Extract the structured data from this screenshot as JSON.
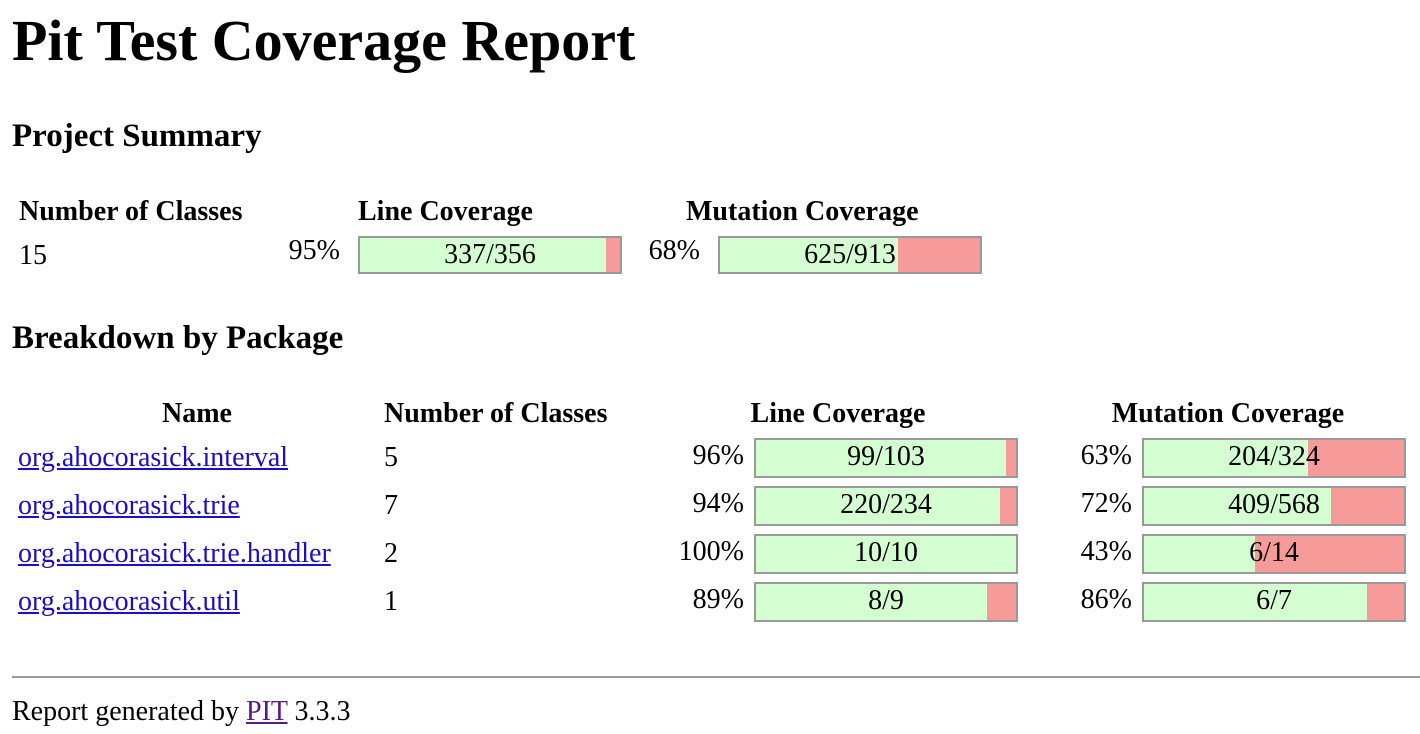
{
  "title": "Pit Test Coverage Report",
  "project_summary": {
    "heading": "Project Summary",
    "headers": {
      "classes": "Number of Classes",
      "line": "Line Coverage",
      "mutation": "Mutation Coverage"
    },
    "classes": "15",
    "line_pct": "95%",
    "line_ratio": "337/356",
    "line_fraction": 0.9466,
    "mutation_pct": "68%",
    "mutation_ratio": "625/913",
    "mutation_fraction": 0.6846
  },
  "breakdown": {
    "heading": "Breakdown by Package",
    "headers": {
      "name": "Name",
      "classes": "Number of Classes",
      "line": "Line Coverage",
      "mutation": "Mutation Coverage"
    },
    "rows": [
      {
        "name": "org.ahocorasick.interval",
        "classes": "5",
        "line_pct": "96%",
        "line_ratio": "99/103",
        "line_fraction": 0.9612,
        "mut_pct": "63%",
        "mut_ratio": "204/324",
        "mut_fraction": 0.6296
      },
      {
        "name": "org.ahocorasick.trie",
        "classes": "7",
        "line_pct": "94%",
        "line_ratio": "220/234",
        "line_fraction": 0.9402,
        "mut_pct": "72%",
        "mut_ratio": "409/568",
        "mut_fraction": 0.7201
      },
      {
        "name": "org.ahocorasick.trie.handler",
        "classes": "2",
        "line_pct": "100%",
        "line_ratio": "10/10",
        "line_fraction": 1.0,
        "mut_pct": "43%",
        "mut_ratio": "6/14",
        "mut_fraction": 0.4286
      },
      {
        "name": "org.ahocorasick.util",
        "classes": "1",
        "line_pct": "89%",
        "line_ratio": "8/9",
        "line_fraction": 0.8889,
        "mut_pct": "86%",
        "mut_ratio": "6/7",
        "mut_fraction": 0.8571
      }
    ]
  },
  "footer": {
    "prefix": "Report generated by",
    "link": "PIT",
    "version": "3.3.3"
  },
  "colors": {
    "covered": "#d5fdd2",
    "uncovered": "#f79a9a",
    "link": "#1a0dcc",
    "visited_link": "#54198b"
  }
}
